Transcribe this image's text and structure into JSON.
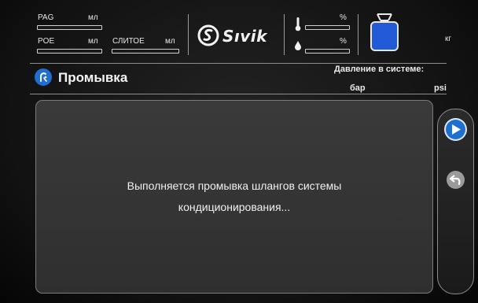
{
  "header": {
    "pag_label": "PAG",
    "pag_unit": "мл",
    "poe_label": "POE",
    "poe_unit": "мл",
    "drain_label": "СЛИТОЕ",
    "drain_unit": "мл",
    "brand": "Sıvik",
    "temp_unit": "%",
    "humidity_unit": "%",
    "tank_unit": "кг"
  },
  "title_bar": {
    "title": "Промывка",
    "pressure_label": "Давление в системе:",
    "pressure_unit_bar": "бар",
    "pressure_unit_psi": "psi"
  },
  "main": {
    "message_line1": "Выполняется промывка шлангов системы",
    "message_line2": "кондиционирования..."
  },
  "icons": {
    "flush": "wash-icon",
    "play": "play-icon",
    "back": "back-arrow-icon",
    "tank": "refrigerant-tank-icon",
    "thermometer": "thermometer-icon",
    "droplet": "droplet-icon",
    "brand_logo": "sivik-logo-icon"
  },
  "colors": {
    "accent_blue": "#1f6fd1",
    "tank_blue": "#2159d6",
    "panel_gray": "#353535"
  }
}
